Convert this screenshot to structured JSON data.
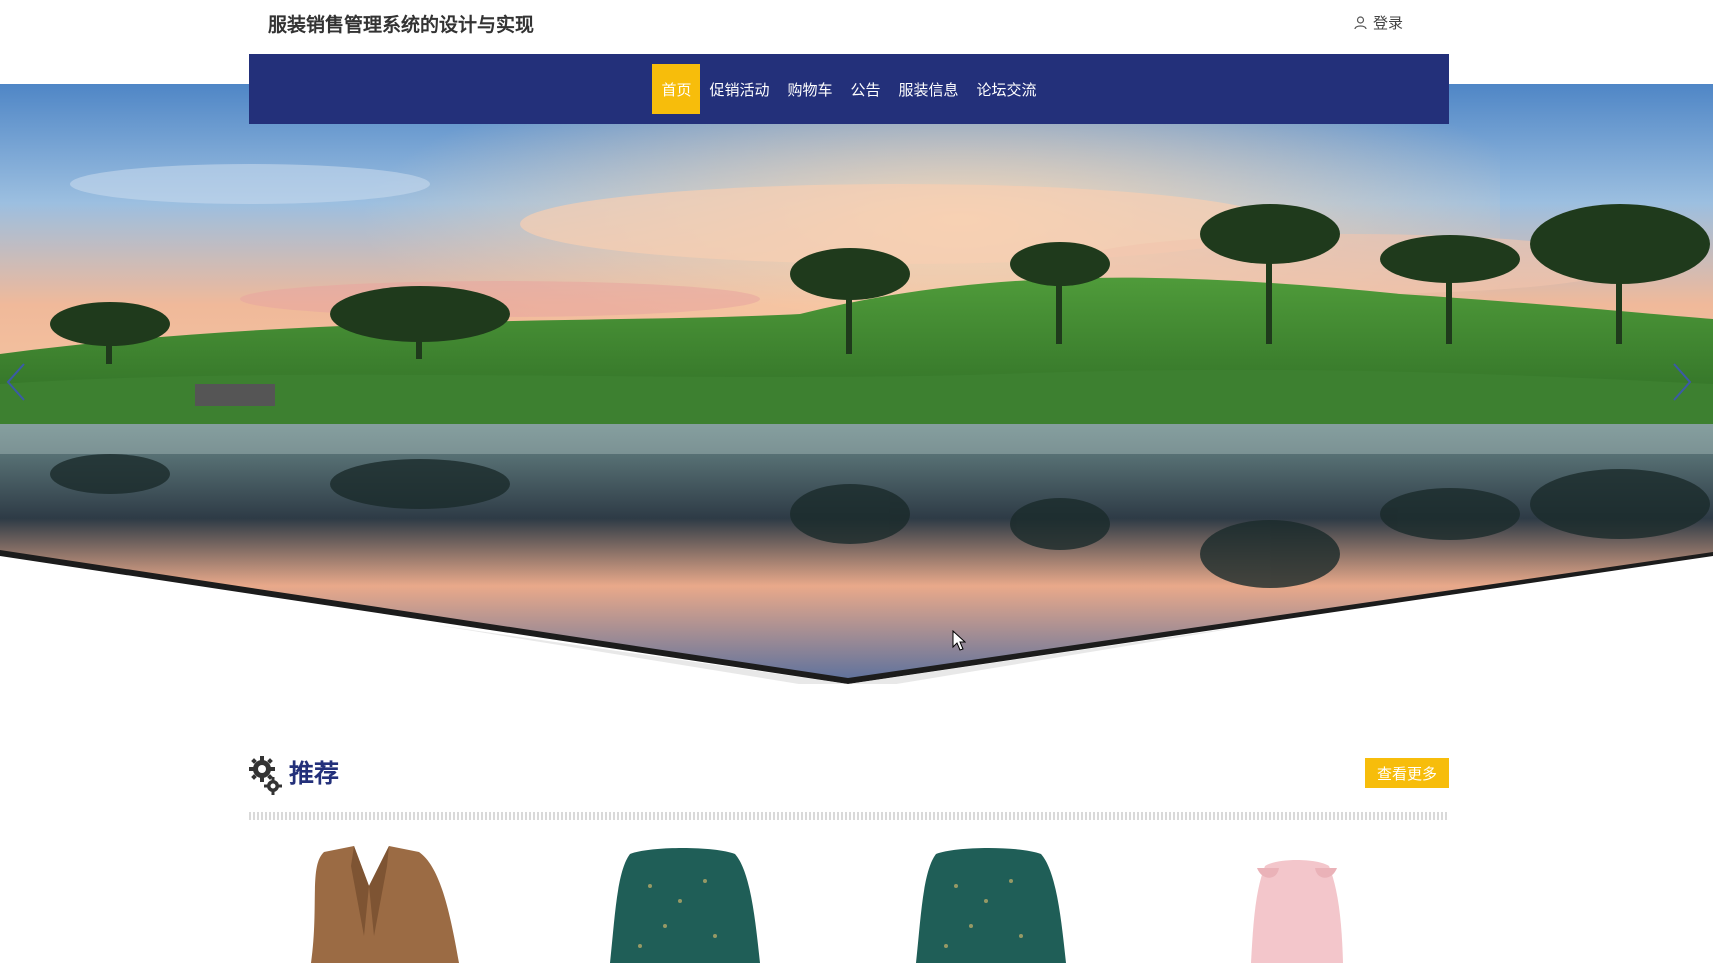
{
  "header": {
    "site_title": "服装销售管理系统的设计与实现",
    "login_label": "登录"
  },
  "nav": {
    "items": [
      {
        "label": "首页",
        "active": true
      },
      {
        "label": "促销活动",
        "active": false
      },
      {
        "label": "购物车",
        "active": false
      },
      {
        "label": "公告",
        "active": false
      },
      {
        "label": "服装信息",
        "active": false
      },
      {
        "label": "论坛交流",
        "active": false
      }
    ]
  },
  "hero": {
    "icons": {
      "prev": "chevron-left-icon",
      "next": "chevron-right-icon"
    }
  },
  "recommend": {
    "title": "推荐",
    "more_label": "查看更多",
    "icon": "gears-icon",
    "products": [
      {
        "image": "brown coat"
      },
      {
        "image": "green floral dress"
      },
      {
        "image": "green floral dress"
      },
      {
        "image": "pink blouse"
      }
    ]
  },
  "colors": {
    "nav_bg": "#23307a",
    "accent": "#f7bd0b",
    "title_blue": "#23307a"
  }
}
